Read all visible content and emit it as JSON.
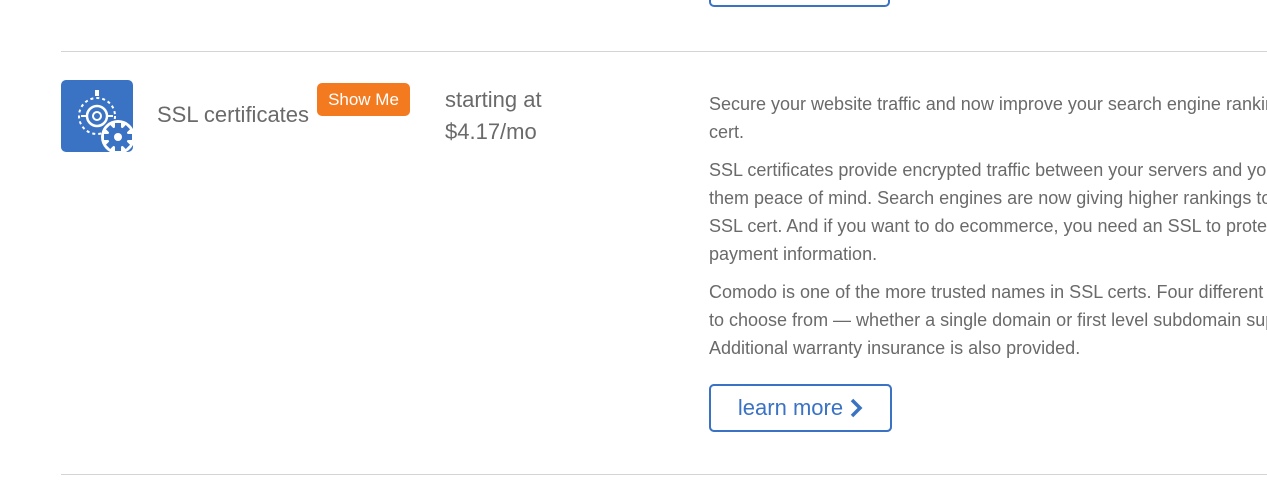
{
  "product": {
    "name": "SSL certificates",
    "badge_label": "Show Me",
    "price_prefix": "starting at",
    "price": "$4.17/mo",
    "icon": "ssl-gear-icon",
    "description": [
      "Secure your website traffic and now improve your search engine rankings with an SSL cert.",
      "SSL certificates provide encrypted traffic between your servers and your visitors to give them peace of mind. Search engines are now giving higher rankings to websites with an SSL cert. And if you want to do ecommerce, you need an SSL to protect your customer’s payment information.",
      "Comodo is one of the more trusted names in SSL certs. Four different levels are available to choose from — whether a single domain or first level subdomain support is needed. Additional warranty insurance is also provided."
    ],
    "learn_more_label": "learn more"
  },
  "colors": {
    "accent_blue": "#3a72c4",
    "badge_orange": "#f47a20",
    "text_gray": "#6a6a6a",
    "divider": "#d4d4d4"
  }
}
